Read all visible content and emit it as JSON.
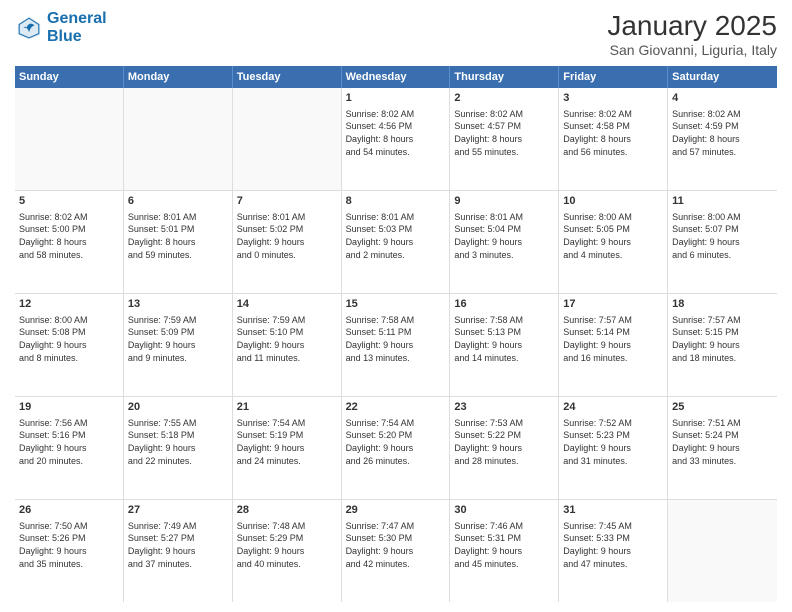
{
  "logo": {
    "line1": "General",
    "line2": "Blue"
  },
  "title": "January 2025",
  "subtitle": "San Giovanni, Liguria, Italy",
  "header_days": [
    "Sunday",
    "Monday",
    "Tuesday",
    "Wednesday",
    "Thursday",
    "Friday",
    "Saturday"
  ],
  "rows": [
    [
      {
        "day": "",
        "text": ""
      },
      {
        "day": "",
        "text": ""
      },
      {
        "day": "",
        "text": ""
      },
      {
        "day": "1",
        "text": "Sunrise: 8:02 AM\nSunset: 4:56 PM\nDaylight: 8 hours\nand 54 minutes."
      },
      {
        "day": "2",
        "text": "Sunrise: 8:02 AM\nSunset: 4:57 PM\nDaylight: 8 hours\nand 55 minutes."
      },
      {
        "day": "3",
        "text": "Sunrise: 8:02 AM\nSunset: 4:58 PM\nDaylight: 8 hours\nand 56 minutes."
      },
      {
        "day": "4",
        "text": "Sunrise: 8:02 AM\nSunset: 4:59 PM\nDaylight: 8 hours\nand 57 minutes."
      }
    ],
    [
      {
        "day": "5",
        "text": "Sunrise: 8:02 AM\nSunset: 5:00 PM\nDaylight: 8 hours\nand 58 minutes."
      },
      {
        "day": "6",
        "text": "Sunrise: 8:01 AM\nSunset: 5:01 PM\nDaylight: 8 hours\nand 59 minutes."
      },
      {
        "day": "7",
        "text": "Sunrise: 8:01 AM\nSunset: 5:02 PM\nDaylight: 9 hours\nand 0 minutes."
      },
      {
        "day": "8",
        "text": "Sunrise: 8:01 AM\nSunset: 5:03 PM\nDaylight: 9 hours\nand 2 minutes."
      },
      {
        "day": "9",
        "text": "Sunrise: 8:01 AM\nSunset: 5:04 PM\nDaylight: 9 hours\nand 3 minutes."
      },
      {
        "day": "10",
        "text": "Sunrise: 8:00 AM\nSunset: 5:05 PM\nDaylight: 9 hours\nand 4 minutes."
      },
      {
        "day": "11",
        "text": "Sunrise: 8:00 AM\nSunset: 5:07 PM\nDaylight: 9 hours\nand 6 minutes."
      }
    ],
    [
      {
        "day": "12",
        "text": "Sunrise: 8:00 AM\nSunset: 5:08 PM\nDaylight: 9 hours\nand 8 minutes."
      },
      {
        "day": "13",
        "text": "Sunrise: 7:59 AM\nSunset: 5:09 PM\nDaylight: 9 hours\nand 9 minutes."
      },
      {
        "day": "14",
        "text": "Sunrise: 7:59 AM\nSunset: 5:10 PM\nDaylight: 9 hours\nand 11 minutes."
      },
      {
        "day": "15",
        "text": "Sunrise: 7:58 AM\nSunset: 5:11 PM\nDaylight: 9 hours\nand 13 minutes."
      },
      {
        "day": "16",
        "text": "Sunrise: 7:58 AM\nSunset: 5:13 PM\nDaylight: 9 hours\nand 14 minutes."
      },
      {
        "day": "17",
        "text": "Sunrise: 7:57 AM\nSunset: 5:14 PM\nDaylight: 9 hours\nand 16 minutes."
      },
      {
        "day": "18",
        "text": "Sunrise: 7:57 AM\nSunset: 5:15 PM\nDaylight: 9 hours\nand 18 minutes."
      }
    ],
    [
      {
        "day": "19",
        "text": "Sunrise: 7:56 AM\nSunset: 5:16 PM\nDaylight: 9 hours\nand 20 minutes."
      },
      {
        "day": "20",
        "text": "Sunrise: 7:55 AM\nSunset: 5:18 PM\nDaylight: 9 hours\nand 22 minutes."
      },
      {
        "day": "21",
        "text": "Sunrise: 7:54 AM\nSunset: 5:19 PM\nDaylight: 9 hours\nand 24 minutes."
      },
      {
        "day": "22",
        "text": "Sunrise: 7:54 AM\nSunset: 5:20 PM\nDaylight: 9 hours\nand 26 minutes."
      },
      {
        "day": "23",
        "text": "Sunrise: 7:53 AM\nSunset: 5:22 PM\nDaylight: 9 hours\nand 28 minutes."
      },
      {
        "day": "24",
        "text": "Sunrise: 7:52 AM\nSunset: 5:23 PM\nDaylight: 9 hours\nand 31 minutes."
      },
      {
        "day": "25",
        "text": "Sunrise: 7:51 AM\nSunset: 5:24 PM\nDaylight: 9 hours\nand 33 minutes."
      }
    ],
    [
      {
        "day": "26",
        "text": "Sunrise: 7:50 AM\nSunset: 5:26 PM\nDaylight: 9 hours\nand 35 minutes."
      },
      {
        "day": "27",
        "text": "Sunrise: 7:49 AM\nSunset: 5:27 PM\nDaylight: 9 hours\nand 37 minutes."
      },
      {
        "day": "28",
        "text": "Sunrise: 7:48 AM\nSunset: 5:29 PM\nDaylight: 9 hours\nand 40 minutes."
      },
      {
        "day": "29",
        "text": "Sunrise: 7:47 AM\nSunset: 5:30 PM\nDaylight: 9 hours\nand 42 minutes."
      },
      {
        "day": "30",
        "text": "Sunrise: 7:46 AM\nSunset: 5:31 PM\nDaylight: 9 hours\nand 45 minutes."
      },
      {
        "day": "31",
        "text": "Sunrise: 7:45 AM\nSunset: 5:33 PM\nDaylight: 9 hours\nand 47 minutes."
      },
      {
        "day": "",
        "text": ""
      }
    ]
  ]
}
